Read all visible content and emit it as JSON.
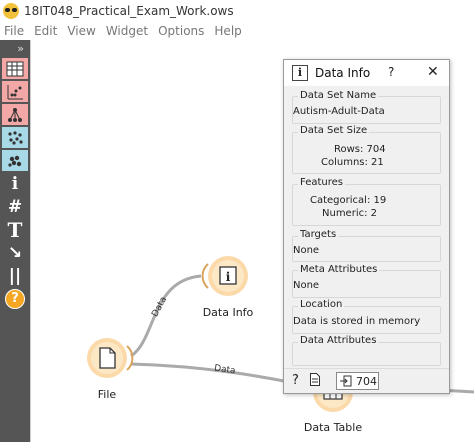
{
  "window": {
    "title": "18IT048_Practical_Exam_Work.ows"
  },
  "menu": [
    "File",
    "Edit",
    "View",
    "Widget",
    "Options",
    "Help"
  ],
  "sidebar": {
    "collapse_glyph": "»",
    "tools": [
      {
        "icon": "table-icon",
        "color": "#f4a7a7"
      },
      {
        "icon": "scatter-plot-icon",
        "color": "#f4a7a7"
      },
      {
        "icon": "tree-icon",
        "color": "#f4a7a7"
      },
      {
        "icon": "distribution-icon",
        "color": "#a7d9e6"
      },
      {
        "icon": "clusters-icon",
        "color": "#a7d9e6"
      }
    ],
    "actions": [
      {
        "icon": "info-icon",
        "glyph": "i"
      },
      {
        "icon": "hash-icon",
        "glyph": "#"
      },
      {
        "icon": "text-icon",
        "glyph": "T"
      },
      {
        "icon": "arrow-icon",
        "glyph": "↘"
      },
      {
        "icon": "pause-icon",
        "glyph": "||"
      },
      {
        "icon": "help-icon",
        "glyph": "?",
        "color": "#f5a623"
      }
    ]
  },
  "canvas": {
    "nodes": {
      "file": "File",
      "data_info": "Data Info",
      "data_table": "Data Table"
    },
    "links": {
      "file_to_info": "Data",
      "file_to_table": "Data"
    }
  },
  "dialog": {
    "title": "Data Info",
    "help_glyph": "?",
    "close_glyph": "✕",
    "sections": {
      "name": {
        "title": "Data Set Name",
        "value": "Autism-Adult-Data"
      },
      "size": {
        "title": "Data Set Size",
        "rows": "Rows: 704",
        "columns": "Columns: 21"
      },
      "features": {
        "title": "Features",
        "categorical": "Categorical: 19",
        "numeric": "Numeric: 2"
      },
      "targets": {
        "title": "Targets",
        "value": "None"
      },
      "meta": {
        "title": "Meta Attributes",
        "value": "None"
      },
      "location": {
        "title": "Location",
        "value": "Data is stored in memory"
      },
      "attributes": {
        "title": "Data Attributes"
      }
    },
    "footer": {
      "help_glyph": "?",
      "count": "704"
    }
  }
}
